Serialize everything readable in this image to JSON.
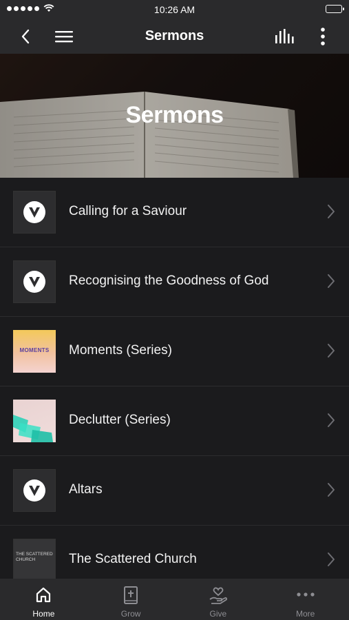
{
  "status_bar": {
    "time": "10:26 AM"
  },
  "nav": {
    "title": "Sermons"
  },
  "hero": {
    "title": "Sermons"
  },
  "list": {
    "items": [
      {
        "label": "Calling for a Saviour",
        "thumb": "v-logo-icon"
      },
      {
        "label": "Recognising the Goodness of God",
        "thumb": "v-logo-icon"
      },
      {
        "label": "Moments (Series)",
        "thumb": "moments-artwork",
        "thumb_text": "MOMENTS"
      },
      {
        "label": "Declutter (Series)",
        "thumb": "declutter-artwork"
      },
      {
        "label": "Altars",
        "thumb": "v-logo-icon"
      },
      {
        "label": "The Scattered Church",
        "thumb": "scattered-church-artwork",
        "thumb_text": "THE SCATTERED CHURCH"
      }
    ]
  },
  "tab_bar": {
    "tabs": [
      {
        "label": "Home",
        "icon": "home-icon",
        "active": true
      },
      {
        "label": "Grow",
        "icon": "bible-icon",
        "active": false
      },
      {
        "label": "Give",
        "icon": "give-hand-heart-icon",
        "active": false
      },
      {
        "label": "More",
        "icon": "more-dots-icon",
        "active": false
      }
    ]
  },
  "colors": {
    "background": "#1b1b1d",
    "bar": "#2a2a2c",
    "active_tab": "#ffffff",
    "inactive_tab": "#8e8e93"
  }
}
